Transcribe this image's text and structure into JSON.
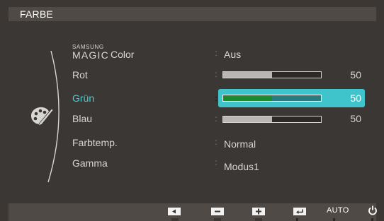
{
  "menu": {
    "title": "FARBE",
    "category_icon": "palette-brush-icon"
  },
  "rows": [
    {
      "brand_small": "SAMSUNG",
      "brand_big": "MAGIC",
      "brand_suffix": "Color",
      "value": "Aus"
    },
    {
      "label": "Rot",
      "level": 50,
      "value": "50"
    },
    {
      "label": "Grün",
      "level": 50,
      "value": "50",
      "selected": true
    },
    {
      "label": "Blau",
      "level": 50,
      "value": "50"
    },
    {
      "label": "Farbtemp.",
      "value": "Normal"
    },
    {
      "label": "Gamma",
      "value": "Modus1"
    }
  ],
  "colon": ":",
  "bar_max": 100,
  "colors": {
    "background": "#3b3734",
    "bar": "#4f4a46",
    "highlight": "#3fc4cb",
    "selected_text": "#3fd0d6",
    "selected_fill": "#1d8a2f"
  },
  "footer": {
    "keys": [
      {
        "icon": "left-arrow-icon"
      },
      {
        "icon": "minus-icon"
      },
      {
        "icon": "plus-icon"
      },
      {
        "icon": "enter-icon"
      },
      {
        "label": "AUTO"
      },
      {
        "icon": "power-icon"
      }
    ]
  }
}
